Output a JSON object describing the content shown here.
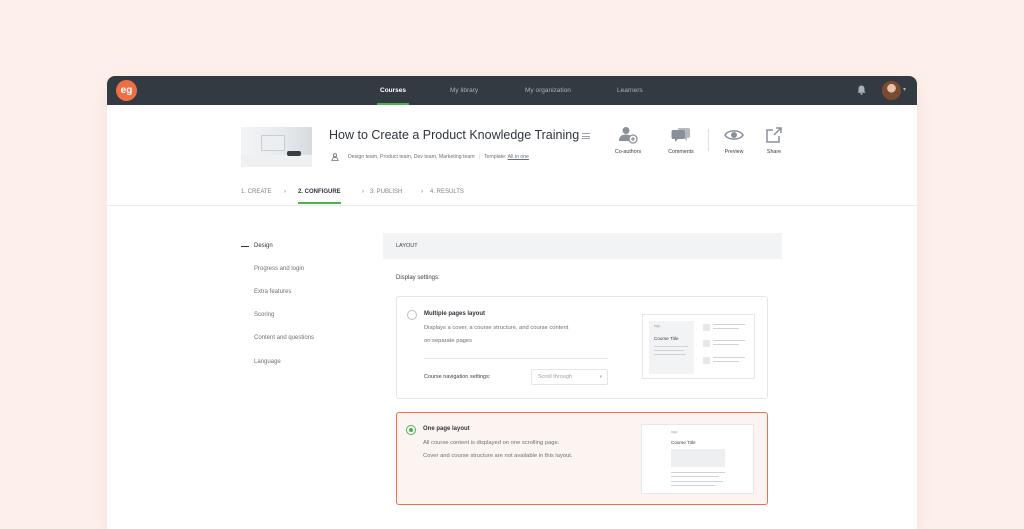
{
  "nav": {
    "logo": "eg",
    "items": [
      "Courses",
      "My library",
      "My organization",
      "Learners"
    ],
    "active_index": 0
  },
  "course": {
    "title": "How to Create a Product Knowledge Training",
    "teams": "Design team, Product team, Dev team, Marketing team",
    "template_label": "Template:",
    "template_value": "All in one"
  },
  "actions": {
    "coauthors": "Co-authors",
    "comments": "Comments",
    "preview": "Preview",
    "share": "Share"
  },
  "steps": [
    "1. CREATE",
    "2. CONFIGURE",
    "3. PUBLISH",
    "4. RESULTS"
  ],
  "active_step": 1,
  "sidebar": {
    "items": [
      "Design",
      "Progress and login",
      "Extra features",
      "Scoring",
      "Content and questions",
      "Language"
    ],
    "active_index": 0
  },
  "layout": {
    "header": "LAYOUT",
    "display_settings": "Display settings:",
    "options": [
      {
        "title": "Multiple pages layout",
        "desc1": "Displays a cover, a course structure, and course content",
        "desc2": "on separate pages",
        "selected": false,
        "nav_settings_label": "Course navigation settings:",
        "nav_settings_value": "Scroll through",
        "preview_logo": "logo",
        "preview_title": "Course Title"
      },
      {
        "title": "One page layout",
        "desc1": "All course content is displayed on one scrolling page.",
        "desc2": "Cover and course structure are not available in this layout.",
        "selected": true,
        "preview_logo": "logo",
        "preview_title": "Course Title"
      }
    ]
  },
  "colors": {
    "background": "#fdf0ec",
    "topbar": "#333a41",
    "accent_green": "#4caf50",
    "accent_orange": "#e8734a"
  }
}
